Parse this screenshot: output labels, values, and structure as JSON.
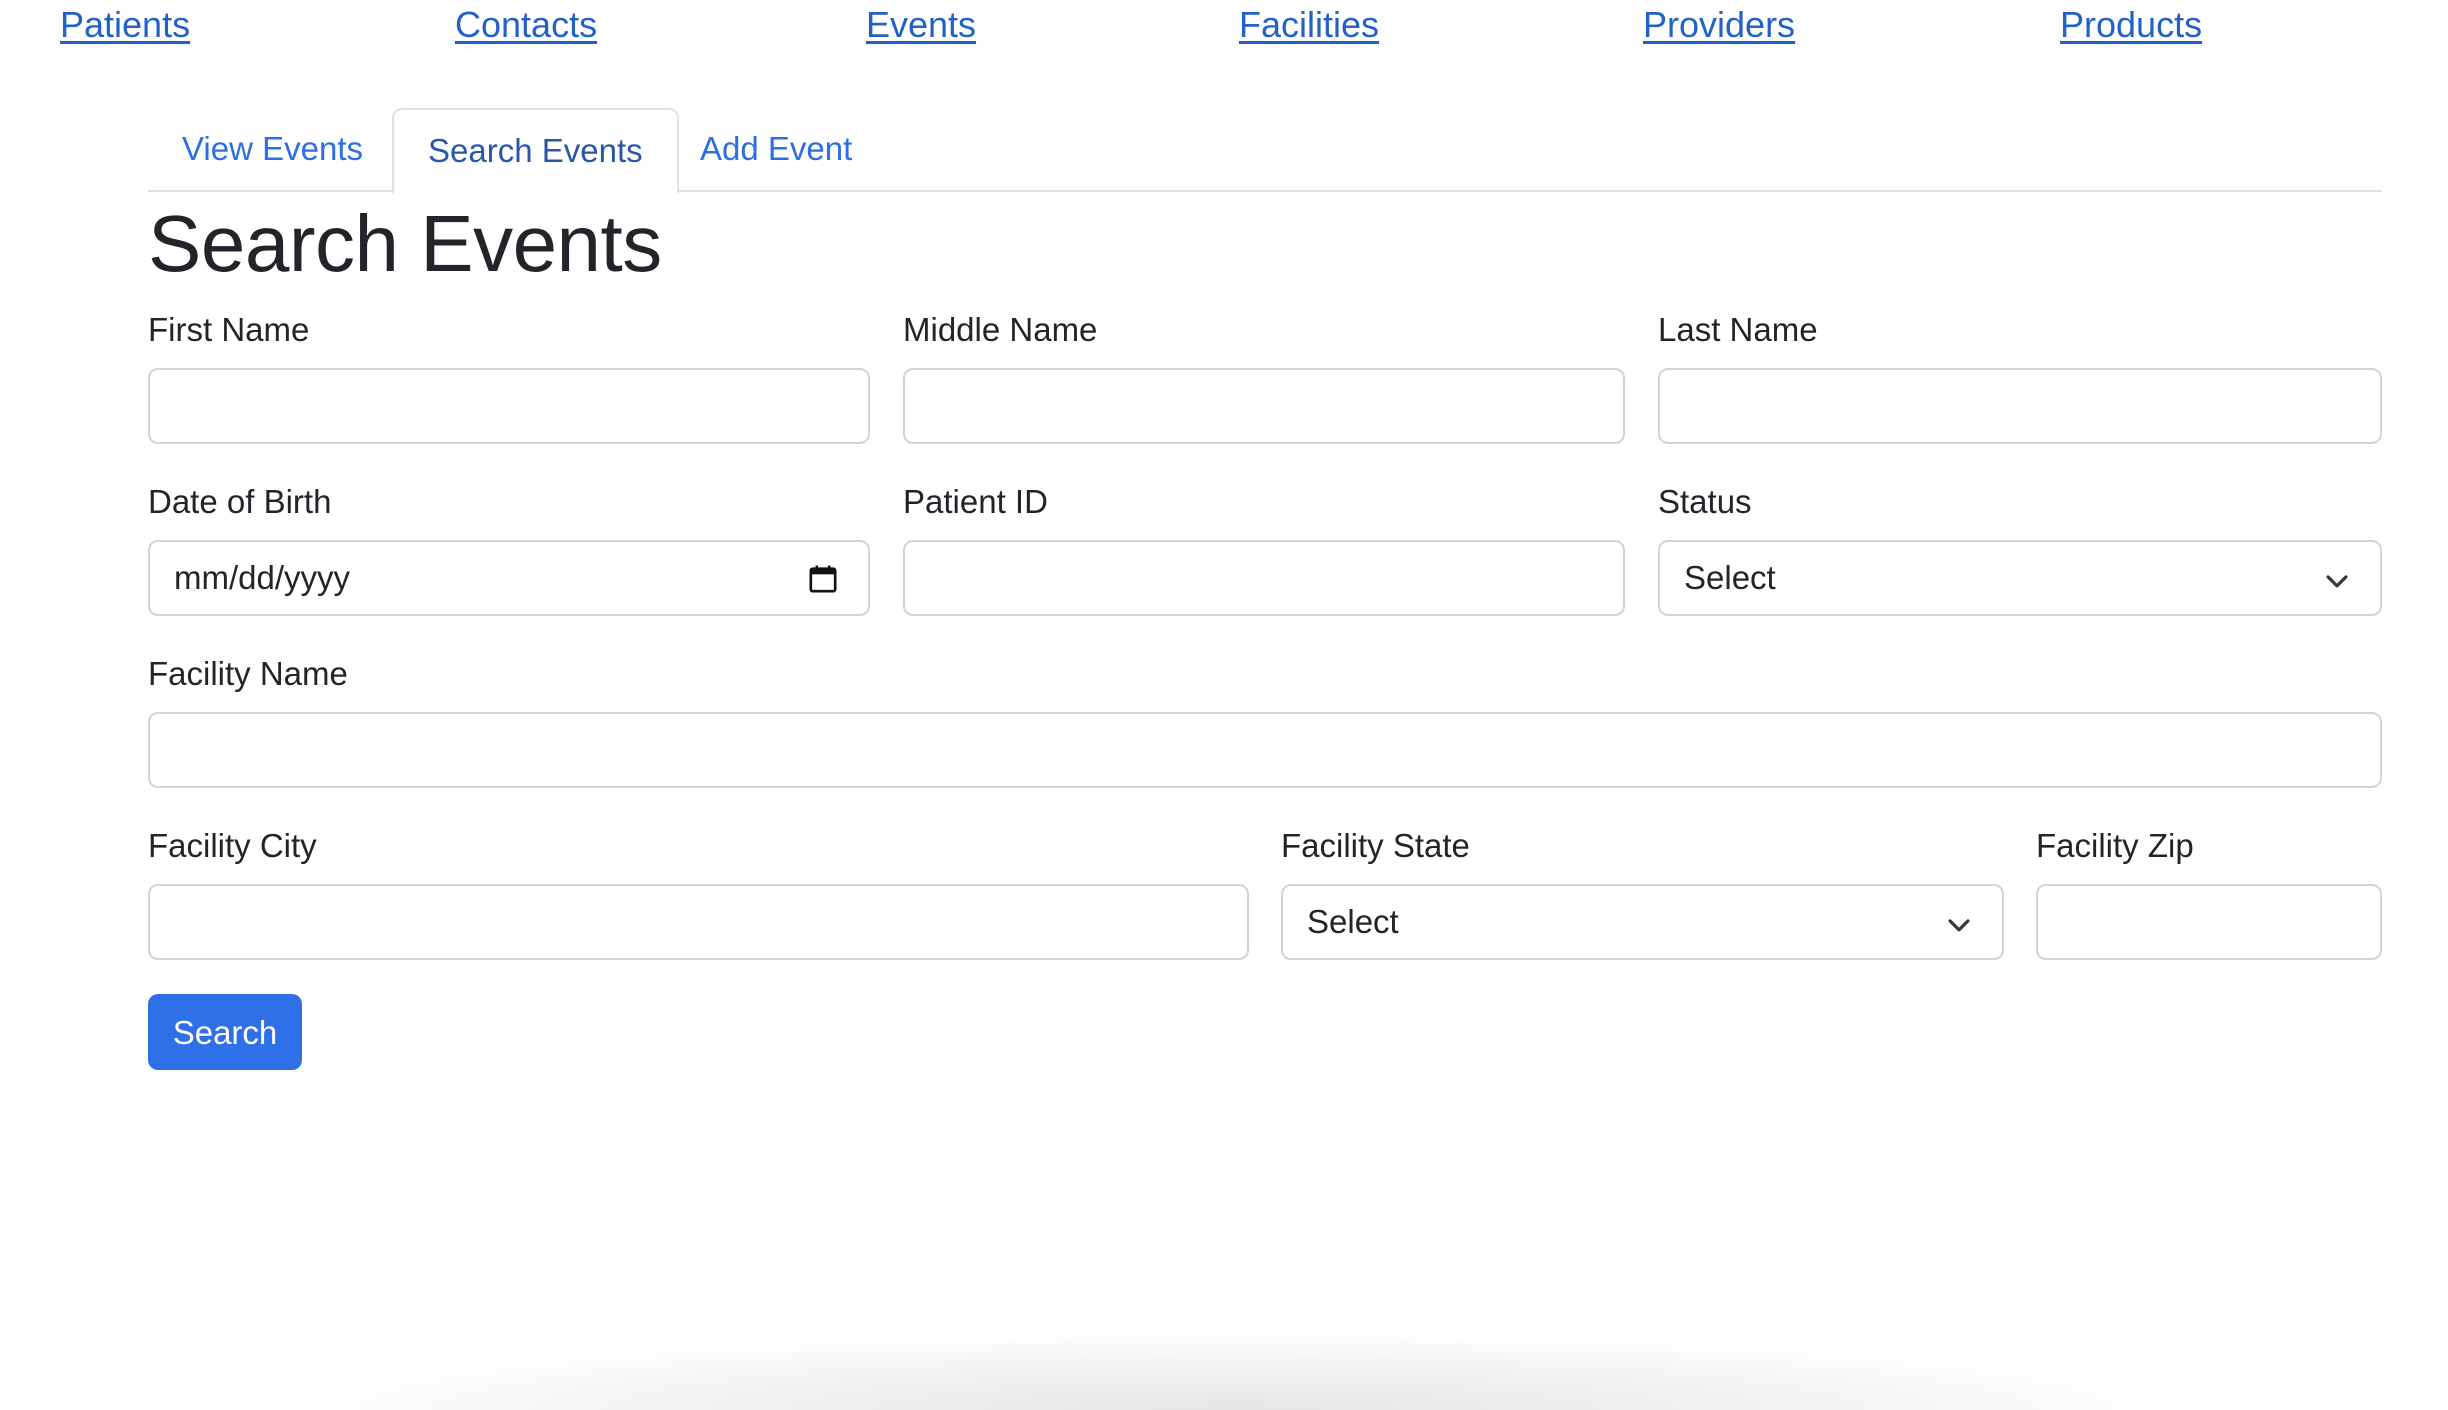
{
  "nav": {
    "links": [
      "Patients",
      "Contacts",
      "Events",
      "Facilities",
      "Providers",
      "Products"
    ]
  },
  "tabs": {
    "items": [
      "View Events",
      "Search Events",
      "Add Event"
    ],
    "active": "Search Events"
  },
  "page": {
    "title": "Search Events"
  },
  "form": {
    "first_name": {
      "label": "First Name",
      "value": ""
    },
    "middle_name": {
      "label": "Middle Name",
      "value": ""
    },
    "last_name": {
      "label": "Last Name",
      "value": ""
    },
    "date_of_birth": {
      "label": "Date of Birth",
      "placeholder": "mm/dd/yyyy",
      "icon": "calendar-icon"
    },
    "patient_id": {
      "label": "Patient ID",
      "value": ""
    },
    "status": {
      "label": "Status",
      "selected": "Select",
      "icon": "chevron-down-icon"
    },
    "facility_name": {
      "label": "Facility Name",
      "value": ""
    },
    "facility_city": {
      "label": "Facility City",
      "value": ""
    },
    "facility_state": {
      "label": "Facility State",
      "selected": "Select",
      "icon": "chevron-down-icon"
    },
    "facility_zip": {
      "label": "Facility Zip",
      "value": ""
    },
    "submit_label": "Search"
  },
  "colors": {
    "link": "#2361c9",
    "tab_text": "#2d6fe0",
    "primary_button": "#2f6fe8",
    "border": "#ced4da"
  }
}
